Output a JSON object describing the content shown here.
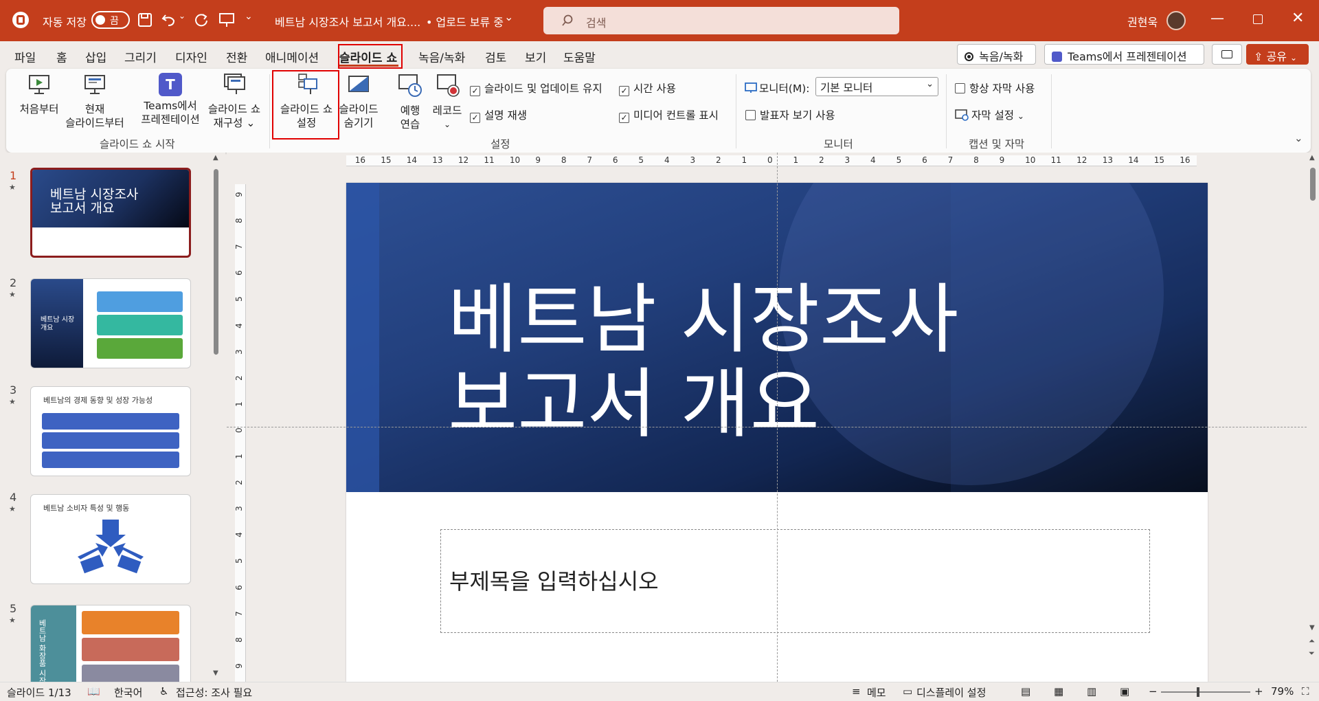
{
  "titlebar": {
    "autosave_label": "자동 저장",
    "autosave_state": "끔",
    "doc_title": "베트남 시장조사 보고서 개요....",
    "upload_status": "• 업로드 보류 중",
    "search_placeholder": "검색",
    "user_name": "권현욱",
    "bg_color": "#c43e1c"
  },
  "menu": {
    "tabs": [
      "파일",
      "홈",
      "삽입",
      "그리기",
      "디자인",
      "전환",
      "애니메이션",
      "슬라이드 쇼",
      "녹음/녹화",
      "검토",
      "보기",
      "도움말"
    ],
    "selected": "슬라이드 쇼",
    "record_button": "녹음/녹화",
    "teams_button": "Teams에서 프레젠테이션",
    "share_button": "공유"
  },
  "ribbon": {
    "from_beginning": "처음부터",
    "from_current_1": "현재",
    "from_current_2": "슬라이드부터",
    "teams_present_1": "Teams에서",
    "teams_present_2": "프레젠테이션",
    "custom_show_1": "슬라이드 쇼",
    "custom_show_2": "재구성",
    "setup_show_1": "슬라이드 쇼",
    "setup_show_2": "설정",
    "hide_slide_1": "슬라이드",
    "hide_slide_2": "숨기기",
    "rehearse_1": "예행",
    "rehearse_2": "연습",
    "record": "레코드",
    "group_start": "슬라이드 쇼 시작",
    "group_setup": "설정",
    "group_monitor": "모니터",
    "group_captions": "캡션 및 자막",
    "cb_keep_updated": "슬라이드 및 업데이트 유지",
    "cb_narration": "설명 재생",
    "cb_timings": "시간 사용",
    "cb_media_controls": "미디어 컨트롤 표시",
    "monitor_label": "모니터(M):",
    "monitor_value": "기본 모니터",
    "presenter_view": "발표자 보기 사용",
    "always_subtitles": "항상 자막 사용",
    "subtitle_settings": "자막 설정"
  },
  "slides": {
    "numbers": [
      "1",
      "2",
      "3",
      "4",
      "5"
    ],
    "s1_title": "베트남 시장조사 보고서 개요",
    "s2_title": "베트남 시장 개요",
    "s3_title": "베트남의 경제 동향 및 성장 가능성",
    "s4_title": "베트남 소비자 특성 및 행동",
    "s5_title": "베트남 화장품 시장"
  },
  "editor": {
    "title_line1": "베트남 시장조사",
    "title_line2": "보고서 개요",
    "subtitle_placeholder": "부제목을 입력하십시오",
    "ruler_ticks": [
      "16",
      "15",
      "14",
      "13",
      "12",
      "11",
      "10",
      "9",
      "8",
      "7",
      "6",
      "5",
      "4",
      "3",
      "2",
      "1",
      "0",
      "1",
      "2",
      "3",
      "4",
      "5",
      "6",
      "7",
      "8",
      "9",
      "10",
      "11",
      "12",
      "13",
      "14",
      "15",
      "16"
    ],
    "vruler_ticks": [
      "9",
      "8",
      "7",
      "6",
      "5",
      "4",
      "3",
      "2",
      "1",
      "0",
      "1",
      "2",
      "3",
      "4",
      "5",
      "6",
      "7",
      "8",
      "9"
    ]
  },
  "status": {
    "slide_counter": "슬라이드 1/13",
    "language": "한국어",
    "accessibility": "접근성: 조사 필요",
    "notes": "메모",
    "display_settings": "디스플레이 설정",
    "zoom": "79%"
  }
}
